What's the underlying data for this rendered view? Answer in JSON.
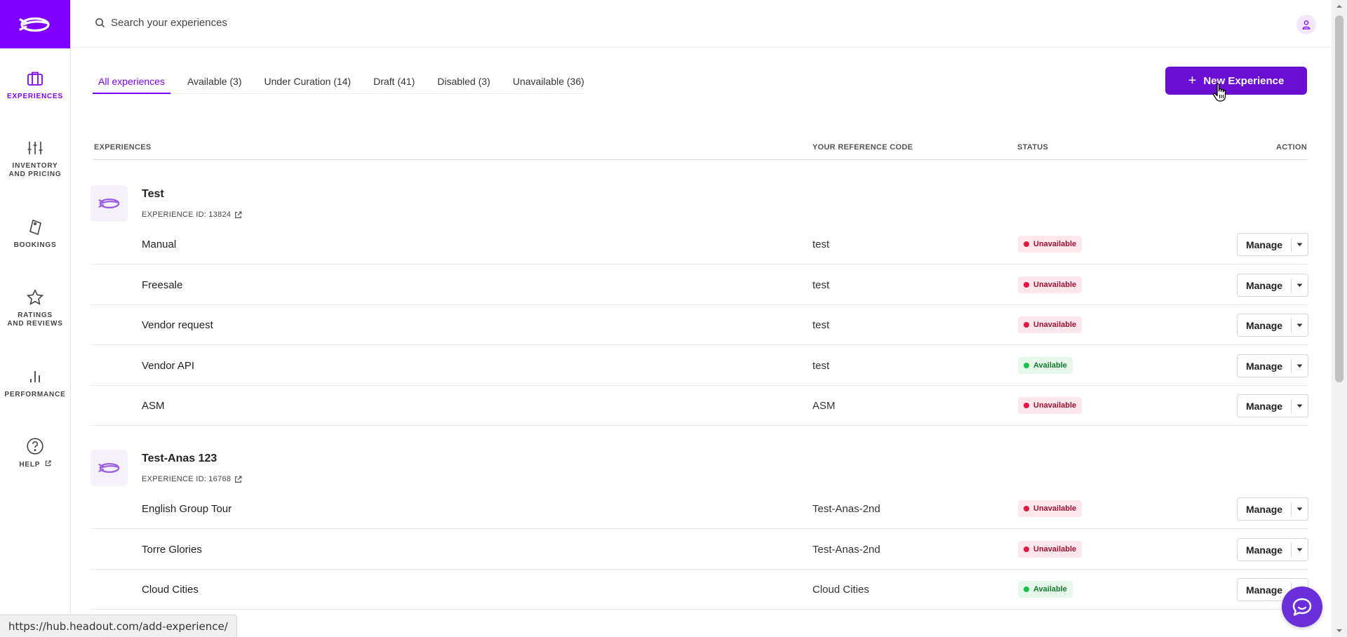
{
  "search": {
    "placeholder": "Search your experiences"
  },
  "sidebar": {
    "items": [
      {
        "label_1": "Experiences",
        "label_2": "",
        "icon": "briefcase-icon",
        "active": true
      },
      {
        "label_1": "Inventory",
        "label_2": "and pricing",
        "icon": "sliders-icon",
        "active": false
      },
      {
        "label_1": "Bookings",
        "label_2": "",
        "icon": "ticket-icon",
        "active": false
      },
      {
        "label_1": "Ratings",
        "label_2": "and reviews",
        "icon": "star-icon",
        "active": false
      },
      {
        "label_1": "Performance",
        "label_2": "",
        "icon": "bar-chart-icon",
        "active": false
      },
      {
        "label_1": "Help",
        "label_2": "",
        "icon": "help-circle-icon",
        "active": false
      }
    ]
  },
  "tabs": [
    {
      "label": "All experiences",
      "active": true
    },
    {
      "label": "Available (3)",
      "active": false
    },
    {
      "label": "Under Curation (14)",
      "active": false
    },
    {
      "label": "Draft (41)",
      "active": false
    },
    {
      "label": "Disabled (3)",
      "active": false
    },
    {
      "label": "Unavailable (36)",
      "active": false
    }
  ],
  "new_button": {
    "label": "New Experience",
    "icon": "plus-icon"
  },
  "table": {
    "headers": {
      "experiences": "Experiences",
      "reference": "Your reference code",
      "status": "Status",
      "action": "Action"
    },
    "groups": [
      {
        "title": "Test",
        "id_label": "Experience ID:",
        "id": "13824",
        "rows": [
          {
            "name": "Manual",
            "ref": "test",
            "status": "Unavailable",
            "available": false
          },
          {
            "name": "Freesale",
            "ref": "test",
            "status": "Unavailable",
            "available": false
          },
          {
            "name": "Vendor request",
            "ref": "test",
            "status": "Unavailable",
            "available": false
          },
          {
            "name": "Vendor API",
            "ref": "test",
            "status": "Available",
            "available": true
          },
          {
            "name": "ASM",
            "ref": "ASM",
            "status": "Unavailable",
            "available": false
          }
        ]
      },
      {
        "title": "Test-Anas 123",
        "id_label": "Experience ID:",
        "id": "16768",
        "rows": [
          {
            "name": "English Group Tour",
            "ref": "Test-Anas-2nd",
            "status": "Unavailable",
            "available": false
          },
          {
            "name": "Torre Glories",
            "ref": "Test-Anas-2nd",
            "status": "Unavailable",
            "available": false
          },
          {
            "name": "Cloud Cities",
            "ref": "Cloud Cities",
            "status": "Available",
            "available": true
          }
        ]
      }
    ],
    "manage_label": "Manage"
  },
  "status_bar": {
    "url": "https://hub.headout.com/add-experience/"
  },
  "colors": {
    "brand": "#8000ff",
    "button": "#6a0fd1",
    "unavailable": "#e6173f",
    "available": "#1cbf4a"
  }
}
